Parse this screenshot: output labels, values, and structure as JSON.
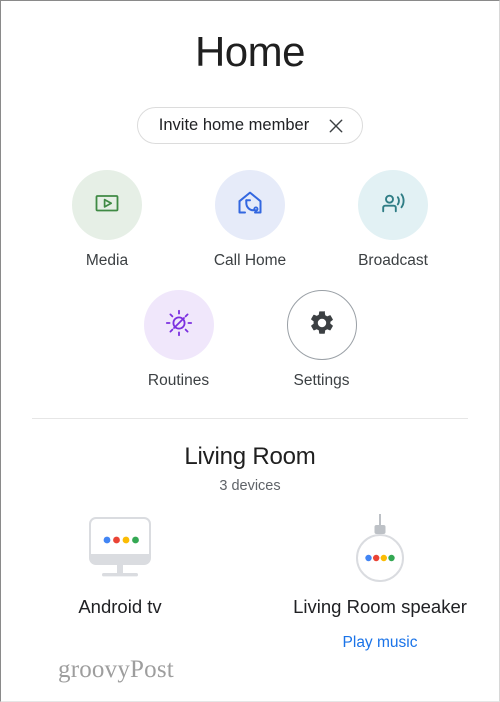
{
  "header": {
    "title": "Home"
  },
  "invite_chip": {
    "label": "Invite home member",
    "close_icon": "close-icon"
  },
  "actions": [
    {
      "id": "media",
      "label": "Media",
      "icon": "video-play-icon",
      "icon_color": "#3f8a44",
      "bg_color": "#e6efe6"
    },
    {
      "id": "call-home",
      "label": "Call Home",
      "icon": "house-phone-icon",
      "icon_color": "#3367e0",
      "bg_color": "#e6ebf9"
    },
    {
      "id": "broadcast",
      "label": "Broadcast",
      "icon": "person-broadcast-icon",
      "icon_color": "#2f7d85",
      "bg_color": "#e2f1f4"
    },
    {
      "id": "routines",
      "label": "Routines",
      "icon": "sun-slash-icon",
      "icon_color": "#7b2fe0",
      "bg_color": "#f0e7fb"
    },
    {
      "id": "settings",
      "label": "Settings",
      "icon": "gear-icon",
      "icon_color": "#3c4043",
      "bg_color": "#ffffff"
    }
  ],
  "room": {
    "name": "Living Room",
    "device_count": "3 devices"
  },
  "devices": [
    {
      "id": "android-tv",
      "name": "Android tv",
      "icon": "tv-monitor-icon",
      "action": ""
    },
    {
      "id": "living-room-speaker",
      "name": "Living Room speaker",
      "icon": "hanging-speaker-icon",
      "action": "Play music",
      "action_color": "#1a73e8"
    }
  ],
  "dot_colors": [
    "#4285f4",
    "#ea4335",
    "#fbbc04",
    "#34a853"
  ],
  "watermark": {
    "text": "groovyPost"
  }
}
